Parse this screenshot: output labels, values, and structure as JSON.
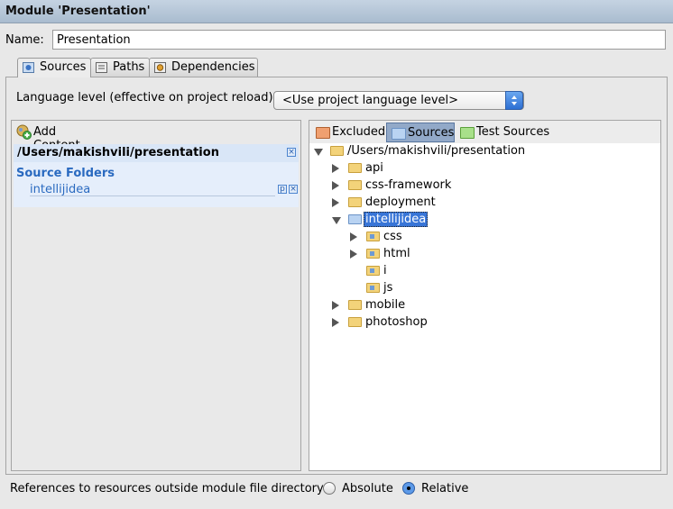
{
  "window": {
    "title": "Module 'Presentation'"
  },
  "name_field": {
    "label": "Name:",
    "value": "Presentation"
  },
  "tabs": [
    {
      "label": "Sources",
      "icon": "sources-tab-icon",
      "active": true
    },
    {
      "label": "Paths",
      "icon": "paths-tab-icon",
      "active": false
    },
    {
      "label": "Dependencies",
      "icon": "dependencies-tab-icon",
      "active": false
    }
  ],
  "language_level": {
    "label": "Language level (effective on project reload):",
    "selected": "<Use project language level>"
  },
  "content_root": {
    "add_label": "Add Content Root",
    "path": "/Users/makishvili/presentation",
    "source_folders_title": "Source Folders",
    "source_folders": [
      "intellijidea"
    ]
  },
  "toolbar": {
    "excluded": "Excluded",
    "sources": "Sources",
    "test_sources": "Test Sources"
  },
  "tree": {
    "root": "/Users/makishvili/presentation",
    "children": [
      {
        "name": "api",
        "expanded": false
      },
      {
        "name": "css-framework",
        "expanded": false
      },
      {
        "name": "deployment",
        "expanded": false
      },
      {
        "name": "intellijidea",
        "expanded": true,
        "selected": true,
        "children": [
          {
            "name": "css",
            "expandable": true
          },
          {
            "name": "html",
            "expandable": true
          },
          {
            "name": "i",
            "expandable": false
          },
          {
            "name": "js",
            "expandable": false
          }
        ]
      },
      {
        "name": "mobile",
        "expanded": false
      },
      {
        "name": "photoshop",
        "expanded": false
      }
    ]
  },
  "references": {
    "label": "References to resources outside module file directory:",
    "options": [
      "Absolute",
      "Relative"
    ],
    "selected": "Relative"
  },
  "colors": {
    "selection": "#3875d7",
    "source_folder": "#2a6ac0",
    "folder": "#f3d37a"
  }
}
